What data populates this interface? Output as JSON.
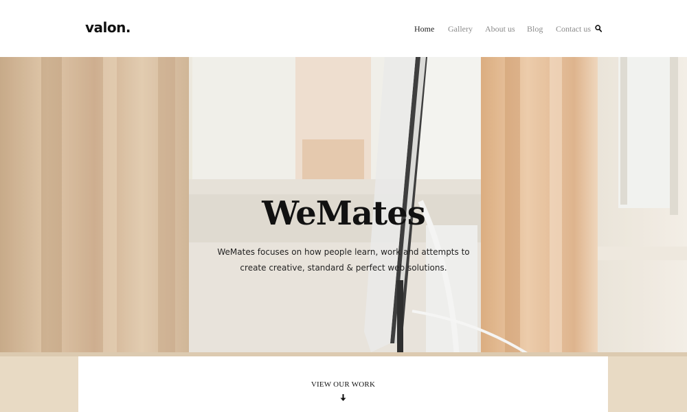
{
  "header": {
    "logo": "valon.",
    "nav": [
      {
        "label": "Home",
        "active": true
      },
      {
        "label": "Gallery",
        "active": false
      },
      {
        "label": "About us",
        "active": false
      },
      {
        "label": "Blog",
        "active": false
      },
      {
        "label": "Contact us",
        "active": false
      }
    ],
    "search_icon": "search-icon"
  },
  "hero": {
    "title": "WeMates",
    "description_line1": "WeMates focuses on how people learn, work and attempts to",
    "description_line2": "create creative, standard & perfect web solutions."
  },
  "card": {
    "cta_label": "VIEW OUR WORK",
    "cta_icon": "arrow-down-icon"
  },
  "colors": {
    "text_dark": "#111111",
    "nav_muted": "#8a8a8a"
  }
}
